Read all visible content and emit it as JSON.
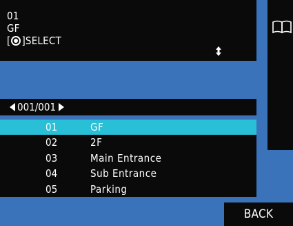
{
  "header": {
    "line1": "01",
    "line2": "GF",
    "select_open": "[",
    "select_close": "]SELECT",
    "select_icon": "dial-button-icon",
    "scroll_icon": "scroll-updown-icon"
  },
  "side_panel": {
    "icon": "book-icon"
  },
  "pager": {
    "text": "001/001",
    "prev_icon": "left-triangle-icon",
    "next_icon": "right-triangle-icon"
  },
  "list": {
    "items": [
      {
        "num": "01",
        "name": "GF",
        "selected": true
      },
      {
        "num": "02",
        "name": "2F",
        "selected": false
      },
      {
        "num": "03",
        "name": "Main Entrance",
        "selected": false
      },
      {
        "num": "04",
        "name": "Sub Entrance",
        "selected": false
      },
      {
        "num": "05",
        "name": "Parking",
        "selected": false
      }
    ]
  },
  "footer": {
    "back_label": "BACK"
  },
  "colors": {
    "background": "#3a73ba",
    "panel": "#0a0a0a",
    "highlight": "#29bfd6",
    "text": "#ffffff"
  }
}
